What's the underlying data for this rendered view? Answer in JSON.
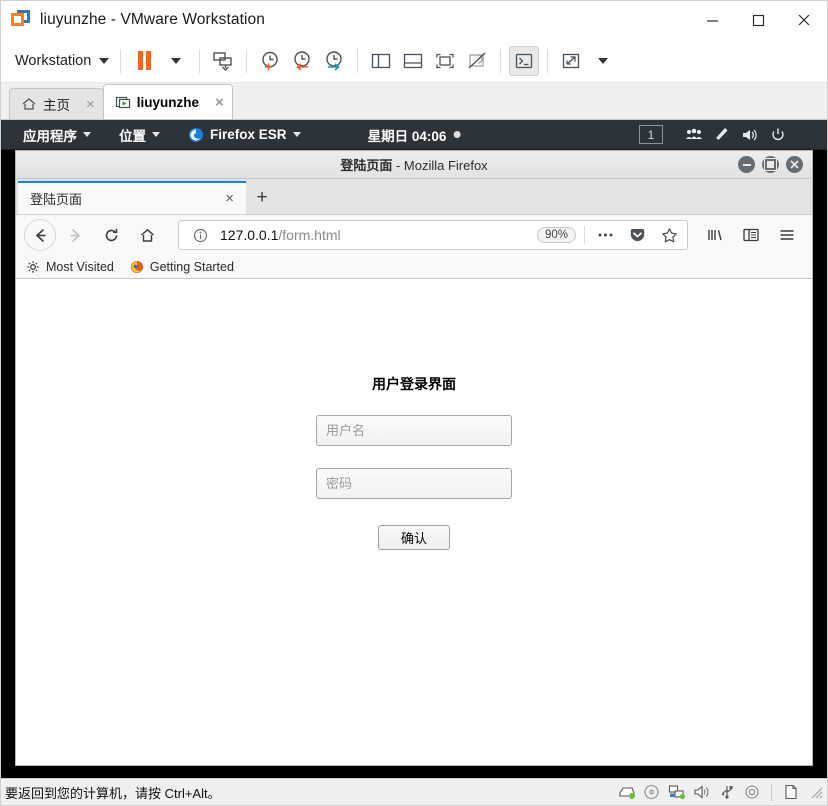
{
  "vmware": {
    "title": "liuyunzhe - VMware Workstation",
    "app_icon": "vmware-logo-icon",
    "window_controls": [
      {
        "name": "minimize-button",
        "glyph": "minimize-icon"
      },
      {
        "name": "maximize-button",
        "glyph": "maximize-icon"
      },
      {
        "name": "close-button",
        "glyph": "close-icon"
      }
    ],
    "toolbar": {
      "menu_label": "Workstation",
      "buttons": [
        {
          "name": "suspend-button",
          "icon": "pause-icon"
        },
        {
          "name": "suspend-dropdown",
          "icon": "chevron-down-icon"
        },
        {
          "name": "power-options-button",
          "icon": "vm-power-icon"
        },
        {
          "name": "snapshot-button",
          "icon": "snapshot-clock-icon"
        },
        {
          "name": "revert-snapshot-button",
          "icon": "revert-snapshot-icon"
        },
        {
          "name": "snapshot-manager-button",
          "icon": "snapshot-manager-icon"
        },
        {
          "name": "show-library-button",
          "icon": "sidebar-panel-icon"
        },
        {
          "name": "show-thumbnails-button",
          "icon": "bottom-panel-icon"
        },
        {
          "name": "fullscreen-button",
          "icon": "fullscreen-icon"
        },
        {
          "name": "unity-mode-button",
          "icon": "unity-mode-icon"
        },
        {
          "name": "console-button",
          "icon": "terminal-icon"
        },
        {
          "name": "stretch-button",
          "icon": "stretch-arrows-icon"
        },
        {
          "name": "stretch-dropdown",
          "icon": "chevron-down-icon"
        }
      ]
    },
    "tabs": [
      {
        "name": "tab-home",
        "label": "主页",
        "icon": "home-icon",
        "close": "×",
        "active": false
      },
      {
        "name": "tab-liuyunzhe",
        "label": "liuyunzhe",
        "icon": "vm-running-icon",
        "close": "×",
        "active": true
      }
    ],
    "statusbar": {
      "message": "要返回到您的计算机，请按 Ctrl+Alt。",
      "devices": [
        {
          "name": "hard-disk-icon"
        },
        {
          "name": "cd-dvd-icon"
        },
        {
          "name": "network-adapter-icon"
        },
        {
          "name": "sound-card-icon"
        },
        {
          "name": "usb-controller-icon"
        },
        {
          "name": "printer-icon"
        }
      ],
      "extra_icon": "document-icon",
      "grip": "resize-grip-icon"
    }
  },
  "gnome_panel": {
    "applications_label": "应用程序",
    "places_label": "位置",
    "firefox_label": "Firefox ESR",
    "clock": "星期日 04:06",
    "workspace": "1",
    "tray": [
      {
        "name": "users-icon"
      },
      {
        "name": "input-method-icon"
      },
      {
        "name": "volume-icon"
      },
      {
        "name": "power-icon"
      },
      {
        "name": "chevron-down-icon"
      }
    ]
  },
  "firefox": {
    "window_title_main": "登陆页面",
    "window_title_sub": " - Mozilla Firefox",
    "window_buttons": [
      {
        "name": "ff-minimize-button"
      },
      {
        "name": "ff-maximize-button"
      },
      {
        "name": "ff-close-button"
      }
    ],
    "tab": {
      "label": "登陆页面",
      "close": "×"
    },
    "newtab_label": "+",
    "nav": {
      "back": "back-arrow-icon",
      "forward": "forward-arrow-icon",
      "reload": "reload-icon",
      "home": "home-icon"
    },
    "urlbar": {
      "identity_icon": "info-circle-icon",
      "host": "127.0.0.1",
      "path": "/form.html",
      "zoom_level": "90%",
      "page_actions_icon": "ellipsis-icon",
      "pocket_icon": "pocket-icon",
      "bookmark_icon": "star-icon"
    },
    "toolbar_right": [
      {
        "name": "library-button",
        "icon": "library-icon"
      },
      {
        "name": "sidebar-button",
        "icon": "sidebar-icon"
      },
      {
        "name": "menu-button",
        "icon": "hamburger-icon"
      }
    ],
    "bookmarks": [
      {
        "name": "bookmark-most-visited",
        "label": "Most Visited",
        "icon": "gear-icon"
      },
      {
        "name": "bookmark-getting-started",
        "label": "Getting Started",
        "icon": "firefox-icon"
      }
    ]
  },
  "page": {
    "heading": "用户登录界面",
    "username_placeholder": "用户名",
    "username_value": "",
    "password_placeholder": "密码",
    "password_value": "",
    "submit_label": "确认"
  },
  "colors": {
    "vmware_orange": "#f26522",
    "vmware_blue": "#2f7ab8",
    "gnome_panel_bg": "#2c3339",
    "firefox_tab_accent": "#0a84ff",
    "guest_bg": "#000000"
  }
}
